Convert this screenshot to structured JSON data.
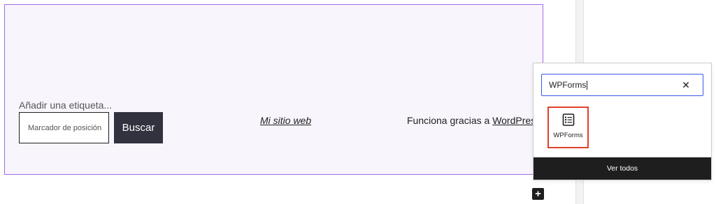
{
  "footer": {
    "search_label": "Añadir una etiqueta...",
    "search_placeholder": "Marcador de posición",
    "search_button": "Buscar",
    "site_title": "Mi sitio web",
    "powered_prefix": "Funciona gracias a ",
    "powered_link": "WordPress"
  },
  "inserter": {
    "search_value": "WPForms",
    "clear_icon": "close-icon",
    "results": [
      {
        "label": "WPForms",
        "icon": "form-icon"
      }
    ],
    "view_all_label": "Ver todos"
  },
  "colors": {
    "selection_border": "#a56be6",
    "block_background": "#f8f5fd",
    "button_dark": "#32323f",
    "focus_blue": "#3858e9",
    "highlight_red": "#e0402b"
  }
}
